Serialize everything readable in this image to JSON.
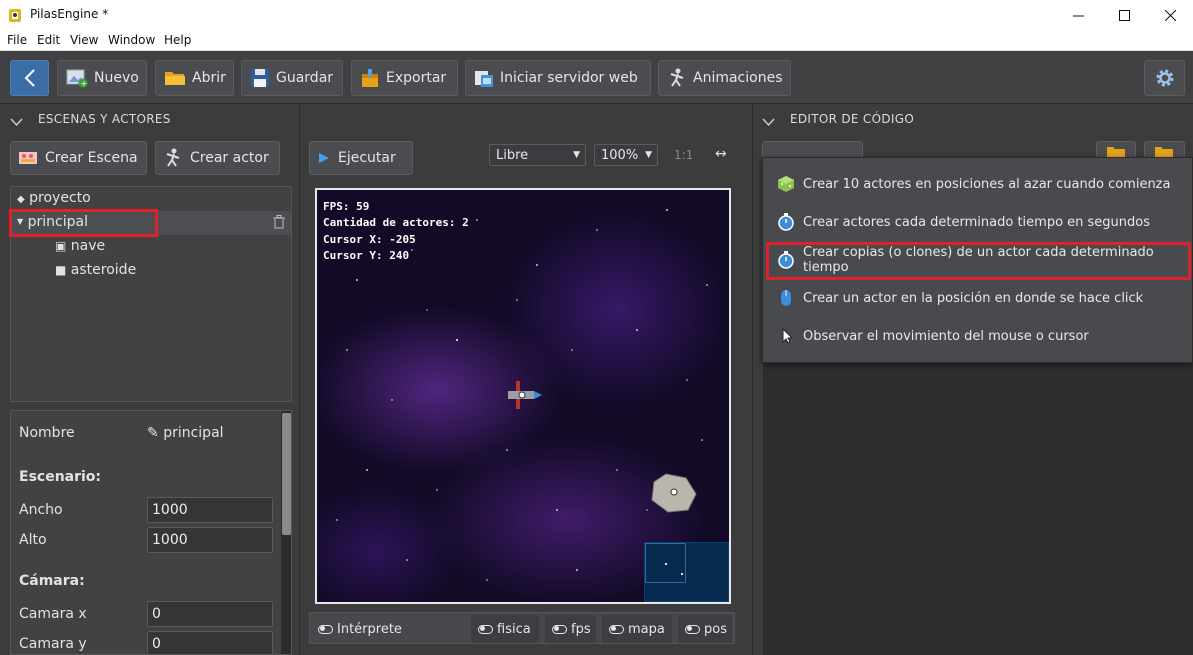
{
  "window": {
    "title": "PilasEngine *"
  },
  "menu": [
    "File",
    "Edit",
    "View",
    "Window",
    "Help"
  ],
  "toolbar": {
    "new": "Nuevo",
    "open": "Abrir",
    "save": "Guardar",
    "export": "Exportar",
    "server": "Iniciar servidor web",
    "animations": "Animaciones"
  },
  "scenes_panel": {
    "title": "ESCENAS Y ACTORES",
    "create_scene": "Crear Escena",
    "create_actor": "Crear actor",
    "tree": {
      "root": "proyecto",
      "scene": "principal",
      "actors": [
        "nave",
        "asteroide"
      ]
    }
  },
  "properties": {
    "name_label": "Nombre",
    "name_value": "principal",
    "stage_heading": "Escenario:",
    "width_label": "Ancho",
    "width_value": "1000",
    "height_label": "Alto",
    "height_value": "1000",
    "camera_heading": "Cámara:",
    "camx_label": "Camara x",
    "camx_value": "0",
    "camy_label": "Camara y",
    "camy_value": "0"
  },
  "canvas": {
    "run": "Ejecutar",
    "mode": "Libre",
    "zoom": "100%",
    "ratio": "1:1",
    "hud": {
      "fps": "FPS: 59",
      "actors": "Cantidad de actores: 2",
      "cursor_x": "Cursor X: -205",
      "cursor_y": "Cursor Y: 240"
    }
  },
  "bottombar": {
    "interpreter": "Intérprete",
    "toggles": [
      "fisica",
      "fps",
      "mapa",
      "pos"
    ]
  },
  "editor": {
    "title": "EDITOR DE CÓDIGO",
    "menu_items": [
      "Crear 10 actores en posiciones al azar cuando comienza",
      "Crear actores cada determinado tiempo en segundos",
      "Crear copias (o clones) de un actor cada determinado tiempo",
      "Crear un actor en la posición en donde se hace click",
      "Observar el movimiento del mouse o cursor"
    ]
  },
  "colors": {
    "highlight": "#e0202a",
    "canvas_bg": "#120a26",
    "minimap": "#062a4e"
  }
}
